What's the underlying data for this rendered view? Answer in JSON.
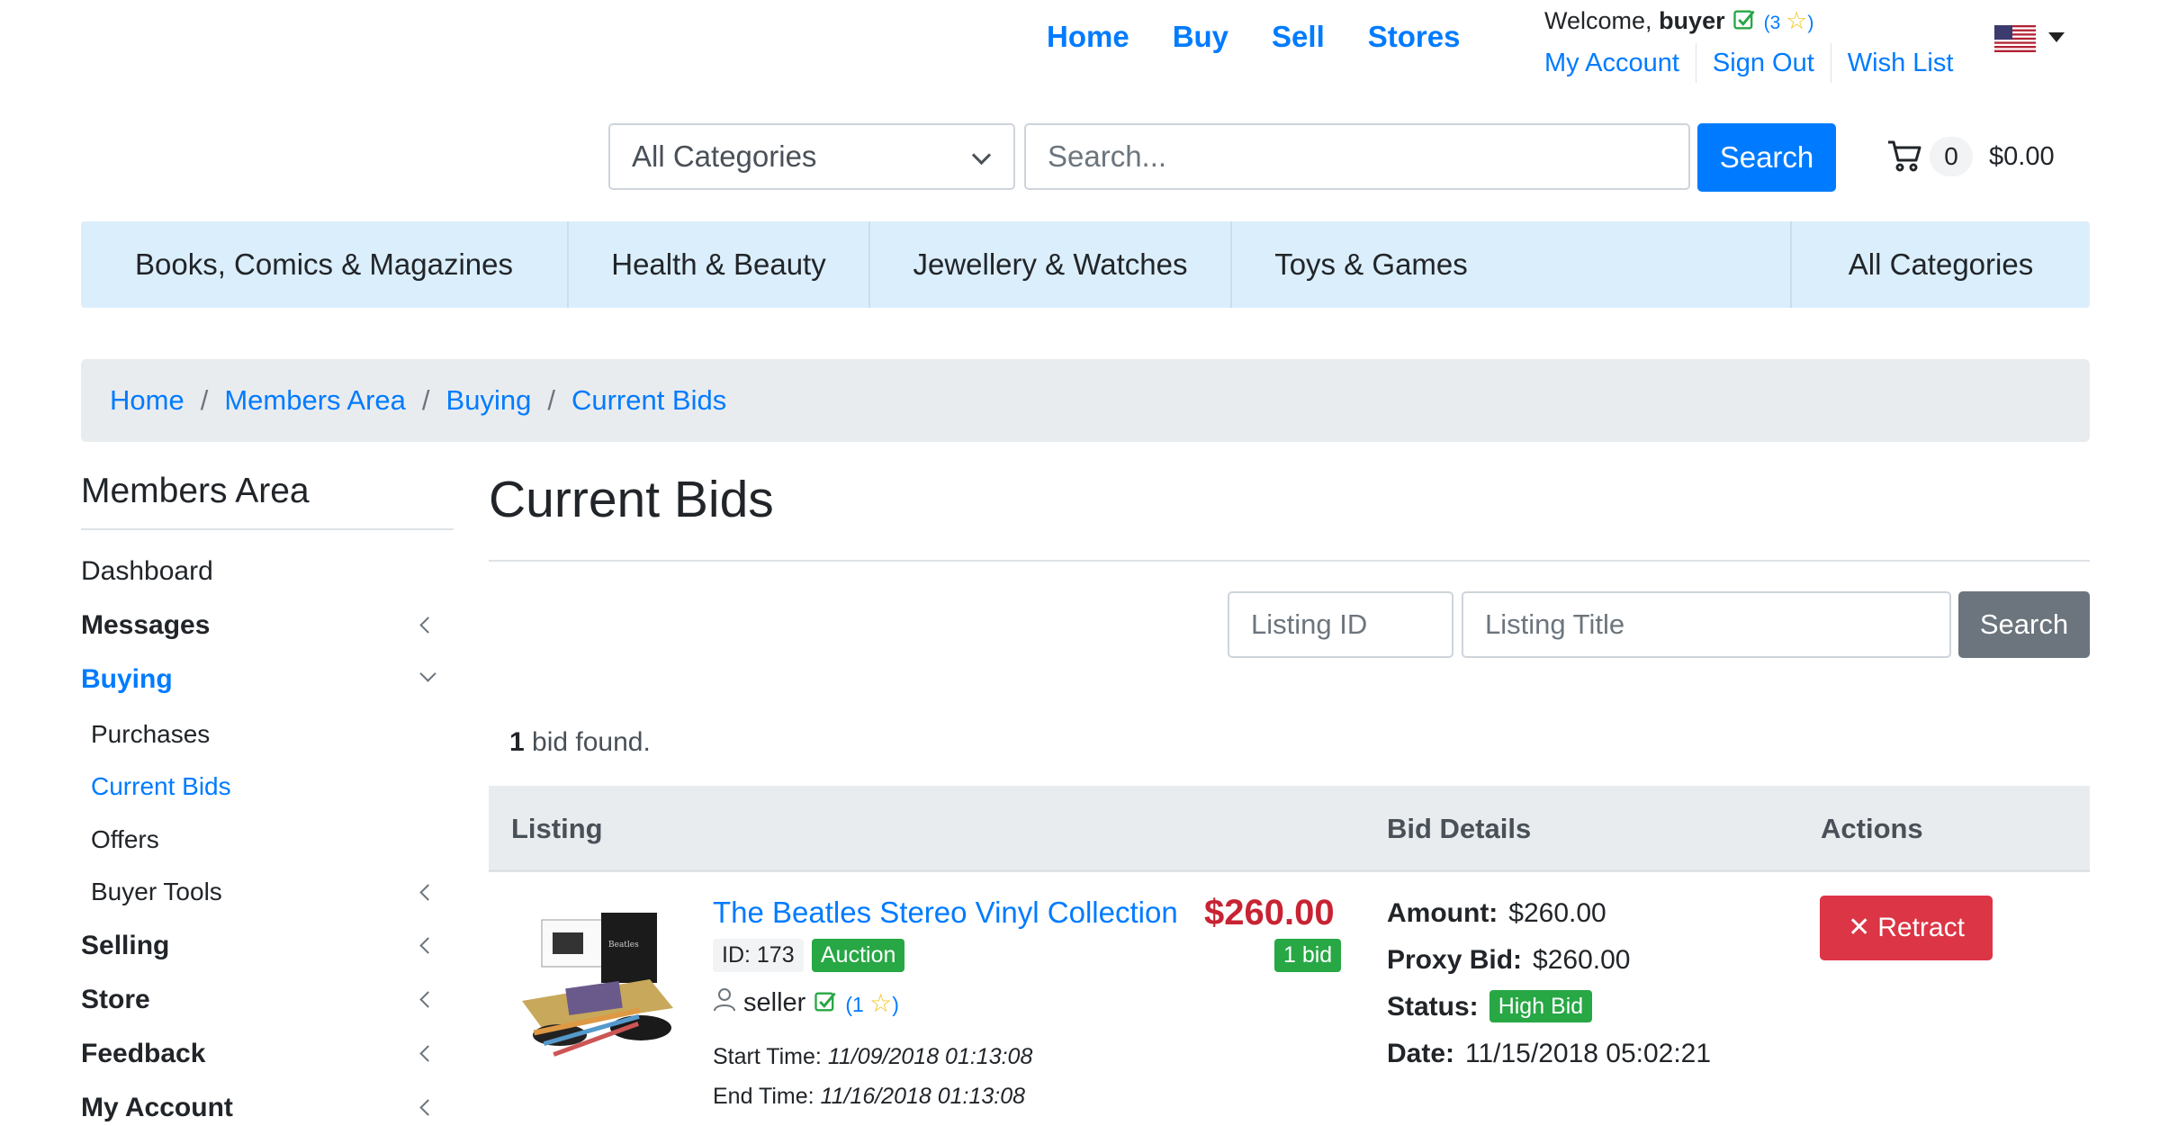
{
  "nav": {
    "home": "Home",
    "buy": "Buy",
    "sell": "Sell",
    "stores": "Stores"
  },
  "user": {
    "welcome": "Welcome,",
    "username": "buyer",
    "rating_open": "(",
    "rating": "3",
    "rating_close": ")",
    "my_account": "My Account",
    "sign_out": "Sign Out",
    "wish_list": "Wish List",
    "locale_icon": "us-flag-icon"
  },
  "search": {
    "category_selected": "All Categories",
    "placeholder": "Search...",
    "button": "Search"
  },
  "cart": {
    "count": "0",
    "total": "$0.00"
  },
  "categories": [
    "Books, Comics & Magazines",
    "Health & Beauty",
    "Jewellery & Watches",
    "Toys & Games",
    "All Categories"
  ],
  "breadcrumb": [
    "Home",
    "Members Area",
    "Buying",
    "Current Bids"
  ],
  "sidebar": {
    "title": "Members Area",
    "items": [
      "Dashboard",
      "Messages",
      "Buying",
      "Purchases",
      "Current Bids",
      "Offers",
      "Buyer Tools",
      "Selling",
      "Store",
      "Feedback",
      "My Account"
    ]
  },
  "main": {
    "title": "Current Bids",
    "filter_id_placeholder": "Listing ID",
    "filter_title_placeholder": "Listing Title",
    "filter_button": "Search",
    "found_count": "1",
    "found_text": " bid found."
  },
  "table": {
    "headers": [
      "Listing",
      "Bid Details",
      "Actions"
    ],
    "rows": [
      {
        "title": "The Beatles Stereo Vinyl Collection",
        "price": "$260.00",
        "bids": "1 bid",
        "id": "ID: 173",
        "type": "Auction",
        "seller": "seller",
        "seller_rating": "1",
        "start_label": "Start Time:",
        "start_time": "11/09/2018 01:13:08",
        "end_label": "End Time:",
        "end_time": "11/16/2018 01:13:08",
        "amount_label": "Amount:",
        "amount": "$260.00",
        "proxy_label": "Proxy Bid:",
        "proxy": "$260.00",
        "status_label": "Status:",
        "status": "High Bid",
        "date_label": "Date:",
        "date": "11/15/2018 05:02:21",
        "action": "Retract"
      }
    ]
  },
  "colors": {
    "primary": "#007bff",
    "danger": "#dc3545",
    "success": "#28a745",
    "secondary": "#6c757d",
    "price": "#c82333"
  }
}
